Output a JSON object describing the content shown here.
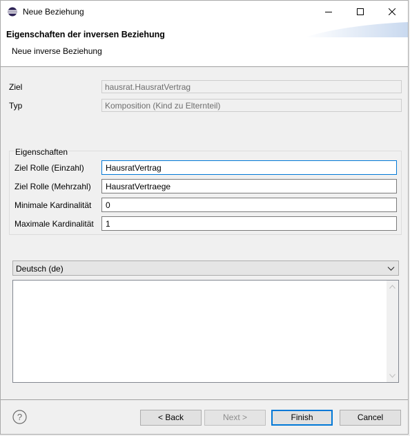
{
  "window": {
    "title": "Neue Beziehung",
    "minimize_icon": "minimize-icon",
    "maximize_icon": "maximize-icon",
    "close_icon": "close-icon"
  },
  "header": {
    "title": "Eigenschaften der inversen Beziehung",
    "subtitle": "Neue inverse Beziehung"
  },
  "fields": {
    "ziel": {
      "label": "Ziel",
      "value": "hausrat.HausratVertrag"
    },
    "typ": {
      "label": "Typ",
      "value": "Komposition (Kind zu Elternteil)"
    }
  },
  "eigenschaften": {
    "legend": "Eigenschaften",
    "rows": [
      {
        "label": "Ziel Rolle (Einzahl)",
        "value": "HausratVertrag"
      },
      {
        "label": "Ziel Rolle (Mehrzahl)",
        "value": "HausratVertraege"
      },
      {
        "label": "Minimale Kardinalität",
        "value": "0"
      },
      {
        "label": "Maximale Kardinalität",
        "value": "1"
      }
    ]
  },
  "language": {
    "selected": "Deutsch (de)"
  },
  "description": {
    "value": ""
  },
  "buttons": {
    "back": "< Back",
    "next": "Next >",
    "finish": "Finish",
    "cancel": "Cancel"
  },
  "colors": {
    "focus_border": "#0078d7",
    "dialog_bg": "#f0f0f0"
  }
}
